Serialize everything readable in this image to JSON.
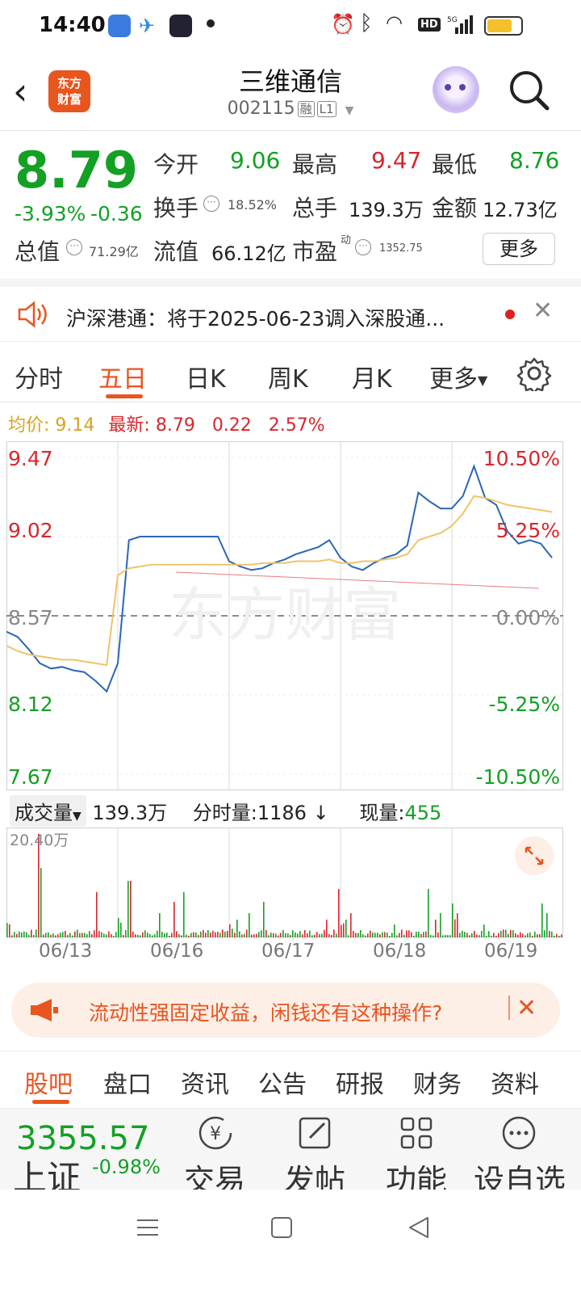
{
  "status_bar": {
    "time": "14:40"
  },
  "header": {
    "logo_line1": "东方",
    "logo_line2": "财富",
    "stock_name": "三维通信",
    "stock_code": "002115",
    "tag1": "融",
    "tag2": "L1"
  },
  "quote": {
    "price": "8.79",
    "change_pct": "-3.93%",
    "change": "-0.36",
    "open_label": "今开",
    "open": "9.06",
    "high_label": "最高",
    "high": "9.47",
    "low_label": "最低",
    "low": "8.76",
    "turnover_label": "换手",
    "turnover": "18.52%",
    "volume_label": "总手",
    "volume": "139.3万",
    "amount_label": "金额",
    "amount": "12.73亿",
    "mktcap_label": "总值",
    "mktcap": "71.29亿",
    "float_label": "流值",
    "float_cap": "66.12亿",
    "pe_label": "市盈",
    "pe_sup": "动",
    "pe": "1352.75",
    "more_button": "更多"
  },
  "notice": {
    "text": "沪深港通：将于2025-06-23调入深股通..."
  },
  "chart_tabs": [
    "分时",
    "五日",
    "日K",
    "周K",
    "月K",
    "更多"
  ],
  "chart_tabs_active": 1,
  "avg_line": {
    "avg_label": "均价:",
    "avg": "9.14",
    "latest_label": "最新:",
    "latest": "8.79",
    "diff": "0.22",
    "diff_pct": "2.57%"
  },
  "chart": {
    "watermark": "东方财富",
    "y_left": [
      "9.47",
      "9.02",
      "8.57",
      "8.12",
      "7.67"
    ],
    "y_right": [
      "10.50%",
      "5.25%",
      "0.00%",
      "-5.25%",
      "-10.50%"
    ],
    "dates": [
      "06/13",
      "06/16",
      "06/17",
      "06/18",
      "06/19"
    ]
  },
  "volume": {
    "selector": "成交量",
    "total": "139.3万",
    "tick_label": "分时量:",
    "tick_value": "1186",
    "current_label": "现量:",
    "current_value": "455",
    "max_label": "20.40万"
  },
  "ad": {
    "text": "流动性强固定收益，闲钱还有这种操作?"
  },
  "bottom_tabs": [
    "股吧",
    "盘口",
    "资讯",
    "公告",
    "研报",
    "财务",
    "资料"
  ],
  "bottom_bar": {
    "index_value": "3355.57",
    "index_name": "上证",
    "index_change": "-0.98%",
    "actions": [
      "交易",
      "发帖",
      "功能",
      "设自选"
    ]
  },
  "chart_data": {
    "type": "line",
    "title": "",
    "xlabel": "",
    "ylabel": "",
    "ylim": [
      7.67,
      9.47
    ],
    "categories": [
      "06/13",
      "06/16",
      "06/17",
      "06/18",
      "06/19"
    ],
    "reference_price": 8.57,
    "series": [
      {
        "name": "",
        "color": "#2a66b8",
        "values": [
          8.48,
          8.45,
          8.38,
          8.3,
          8.27,
          8.28,
          8.26,
          8.25,
          8.2,
          8.14,
          8.3,
          9.0,
          9.02,
          9.02,
          9.02,
          9.02,
          9.02,
          9.02,
          9.02,
          9.02,
          8.88,
          8.85,
          8.83,
          8.84,
          8.87,
          8.89,
          8.92,
          8.94,
          8.96,
          9.0,
          8.9,
          8.85,
          8.83,
          8.87,
          8.9,
          8.92,
          8.97,
          9.27,
          9.22,
          9.18,
          9.18,
          9.25,
          9.42,
          9.24,
          9.2,
          9.05,
          8.98,
          9.0,
          8.98,
          8.9
        ]
      },
      {
        "name": "均价",
        "color": "#f0c36a",
        "values": [
          8.4,
          8.37,
          8.35,
          8.34,
          8.33,
          8.32,
          8.32,
          8.31,
          8.3,
          8.29,
          8.8,
          8.84,
          8.85,
          8.86,
          8.86,
          8.86,
          8.86,
          8.86,
          8.86,
          8.86,
          8.86,
          8.86,
          8.86,
          8.87,
          8.87,
          8.87,
          8.88,
          8.88,
          8.88,
          8.89,
          8.87,
          8.87,
          8.88,
          8.88,
          8.89,
          8.9,
          8.92,
          9.0,
          9.02,
          9.04,
          9.08,
          9.15,
          9.25,
          9.24,
          9.22,
          9.2,
          9.19,
          9.18,
          9.17,
          9.16
        ]
      }
    ]
  },
  "colors": {
    "brand": "#e8551f",
    "up": "#d9262c",
    "down": "#13a024",
    "line": "#2a66b8",
    "avg": "#f0c36a"
  }
}
